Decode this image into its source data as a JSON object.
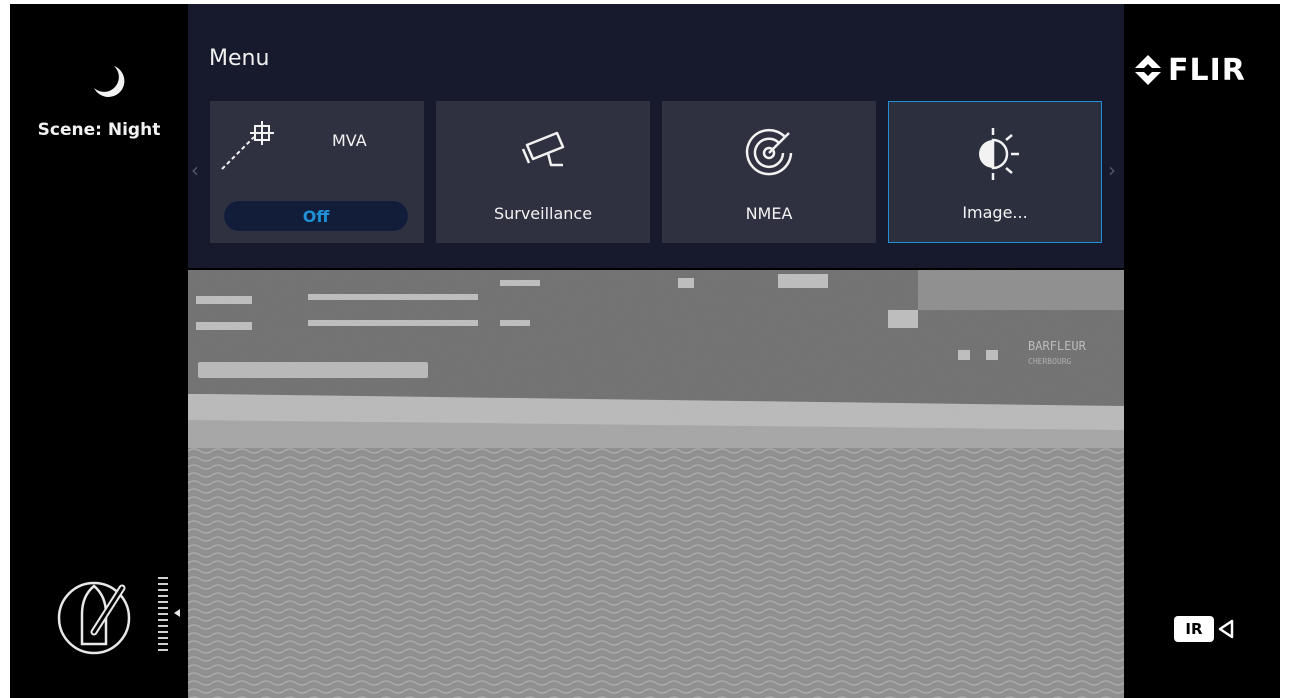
{
  "scene": {
    "label": "Scene: Night",
    "icon": "moon-icon"
  },
  "menu": {
    "title": "Menu",
    "tiles": [
      {
        "label": "MVA",
        "icon": "mva-crosshair-icon",
        "toggle": "Off"
      },
      {
        "label": "Surveillance",
        "icon": "security-camera-icon"
      },
      {
        "label": "NMEA",
        "icon": "radar-icon"
      },
      {
        "label": "Image...",
        "icon": "brightness-contrast-icon",
        "selected": true
      }
    ],
    "scroll_left": "‹",
    "scroll_right": "›"
  },
  "brand": {
    "name": "FLIR",
    "icon": "flir-logo-icon"
  },
  "camera_mode": {
    "label": "IR",
    "icon": "video-camera-icon"
  },
  "feed": {
    "vessel_name": "BARFLEUR",
    "vessel_port": "CHERBOURG"
  },
  "colors": {
    "accent": "#1f8fd6",
    "menu_bg": "#171a2d",
    "tile_bg": "#2f3140"
  }
}
